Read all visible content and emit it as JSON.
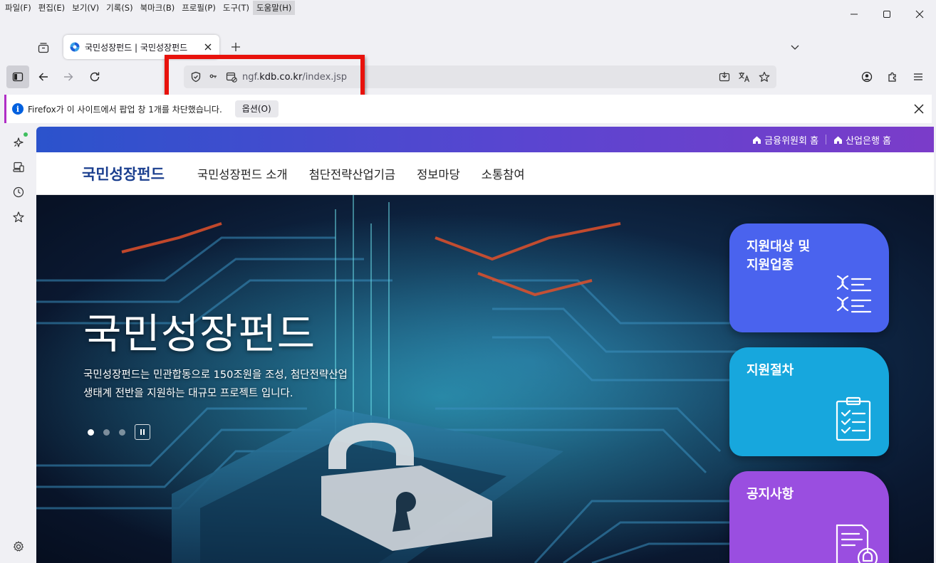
{
  "menubar": {
    "items": [
      "파일(F)",
      "편집(E)",
      "보기(V)",
      "기록(S)",
      "북마크(B)",
      "프로필(P)",
      "도구(T)",
      "도움말(H)"
    ],
    "active_index": 7
  },
  "window_controls": {
    "minimize": "minimize-icon",
    "maximize": "maximize-icon",
    "close": "close-icon"
  },
  "tabs": [
    {
      "title": "국민성장펀드 | 국민성장펀드",
      "favicon": "kdb-favicon",
      "active": true
    }
  ],
  "urlbar": {
    "url_prefix": "ngf.",
    "url_domain": "kdb.co.kr",
    "url_path": "/index.jsp"
  },
  "notification": {
    "text": "Firefox가 이 사이트에서 팝업 창 1개를 차단했습니다.",
    "button_label": "옵션(O)"
  },
  "site": {
    "top_links": [
      "금융위원회 홈",
      "산업은행 홈"
    ],
    "logo": "국민성장펀드",
    "nav": [
      "국민성장펀드 소개",
      "첨단전략산업기금",
      "정보마당",
      "소통참여"
    ],
    "hero": {
      "title": "국민성장펀드",
      "desc_line1": "국민성장펀드는 민관합동으로 150조원을 조성, 첨단전략산업",
      "desc_line2": "생태계 전반을 지원하는 대규모 프로젝트 입니다.",
      "slide_count": 3,
      "active_slide": 1
    },
    "quick_cards": [
      {
        "title": "지원대상 및\n지원업종",
        "icon": "dna-list-icon",
        "color": "#4a63ee"
      },
      {
        "title": "지원절차",
        "icon": "clipboard-check-icon",
        "color": "#17a7dd"
      },
      {
        "title": "공지사항",
        "icon": "notice-document-icon",
        "color": "#9a4ee0"
      }
    ]
  },
  "colors": {
    "highlight_box": "#e8120c",
    "top_band_start": "#2b53cc",
    "top_band_end": "#7b3cc9",
    "logo": "#1b3f8f"
  }
}
